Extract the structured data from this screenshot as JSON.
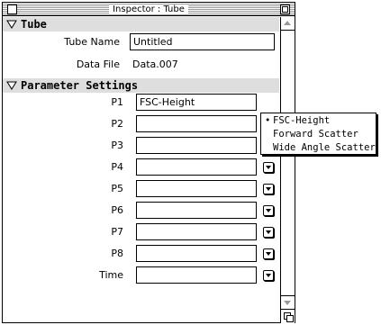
{
  "window": {
    "title": "Inspector : Tube"
  },
  "sections": {
    "tube": {
      "label": "Tube"
    },
    "params": {
      "label": "Parameter Settings"
    }
  },
  "tube": {
    "name_label": "Tube Name",
    "name_value": "Untitled",
    "file_label": "Data File",
    "file_value": "Data.007"
  },
  "params": [
    {
      "label": "P1",
      "value": "FSC-Height"
    },
    {
      "label": "P2",
      "value": ""
    },
    {
      "label": "P3",
      "value": ""
    },
    {
      "label": "P4",
      "value": ""
    },
    {
      "label": "P5",
      "value": ""
    },
    {
      "label": "P6",
      "value": ""
    },
    {
      "label": "P7",
      "value": ""
    },
    {
      "label": "P8",
      "value": ""
    },
    {
      "label": "Time",
      "value": ""
    }
  ],
  "popup_menu": {
    "check_mark": "•",
    "items": [
      {
        "label": "FSC-Height",
        "checked": true
      },
      {
        "label": "Forward Scatter",
        "checked": false
      },
      {
        "label": "Wide Angle Scatter",
        "checked": false
      }
    ]
  },
  "icons": {
    "close": "close-box-icon",
    "zoom": "zoom-box-icon",
    "disclosure": "disclosure-triangle-icon",
    "popup": "popup-arrow-icon",
    "grow": "grow-box-icon"
  }
}
